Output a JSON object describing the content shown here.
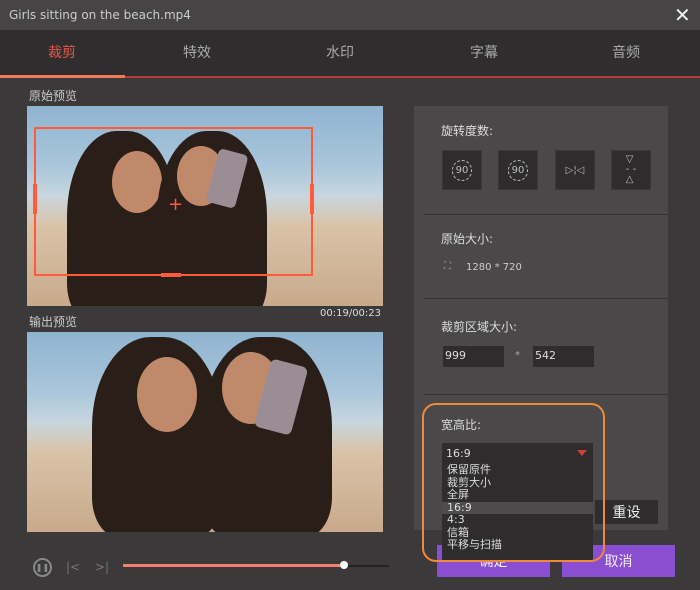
{
  "window": {
    "title": "Girls sitting on the beach.mp4",
    "close_icon": "close-icon"
  },
  "tabs": [
    {
      "label": "裁剪",
      "active": true
    },
    {
      "label": "特效"
    },
    {
      "label": "水印"
    },
    {
      "label": "字幕"
    },
    {
      "label": "音频"
    }
  ],
  "preview": {
    "original_label": "原始预览",
    "output_label": "输出预览",
    "time": "00:19/00:23",
    "progress": 0.83
  },
  "panel": {
    "rotation_label": "旋转度数:",
    "rotate_left": "90",
    "rotate_right": "90",
    "original_size_label": "原始大小:",
    "original_size": "1280 * 720",
    "crop_size_label": "裁剪区域大小:",
    "crop_width": "999",
    "crop_sep": "*",
    "crop_height": "542",
    "aspect_label": "宽高比:",
    "aspect_value": "16:9",
    "aspect_options": [
      "保留原件",
      "裁剪大小",
      "全屏",
      "16:9",
      "4:3",
      "信箱",
      "平移与扫描"
    ],
    "reset": "重设"
  },
  "buttons": {
    "ok": "确定",
    "cancel": "取消"
  },
  "colors": {
    "accent": "#f07a5a",
    "button": "#8a4fd0",
    "highlight": "#f08a3a"
  }
}
